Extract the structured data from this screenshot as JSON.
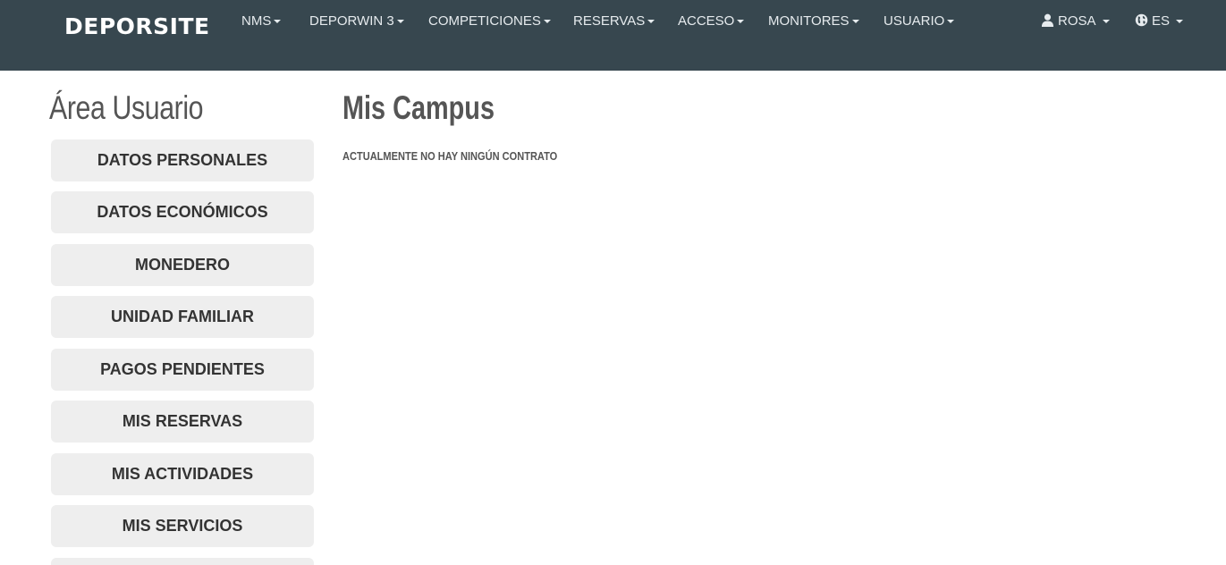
{
  "navbar": {
    "brand": "DEPORSITE",
    "menu": [
      {
        "label": "NMS"
      },
      {
        "label": "DEPORWIN 3"
      },
      {
        "label": "COMPETICIONES"
      },
      {
        "label": "RESERVAS"
      },
      {
        "label": "ACCESO"
      },
      {
        "label": "MONITORES"
      },
      {
        "label": "USUARIO"
      }
    ],
    "user": {
      "label": "ROSA",
      "icon": "user-icon"
    },
    "language": {
      "label": "ES",
      "icon": "globe-icon"
    },
    "colors": {
      "background": "#37474f",
      "text": "#e6ebee"
    }
  },
  "sidebar": {
    "title": "Área Usuario",
    "items": [
      {
        "label": "DATOS PERSONALES"
      },
      {
        "label": "DATOS ECONÓMICOS"
      },
      {
        "label": "MONEDERO"
      },
      {
        "label": "UNIDAD FAMILIAR"
      },
      {
        "label": "PAGOS PENDIENTES"
      },
      {
        "label": "MIS RESERVAS"
      },
      {
        "label": "MIS ACTIVIDADES"
      },
      {
        "label": "MIS SERVICIOS"
      }
    ]
  },
  "main": {
    "title": "Mis Campus",
    "message": "ACTUALMENTE NO HAY NINGÚN CONTRATO"
  }
}
